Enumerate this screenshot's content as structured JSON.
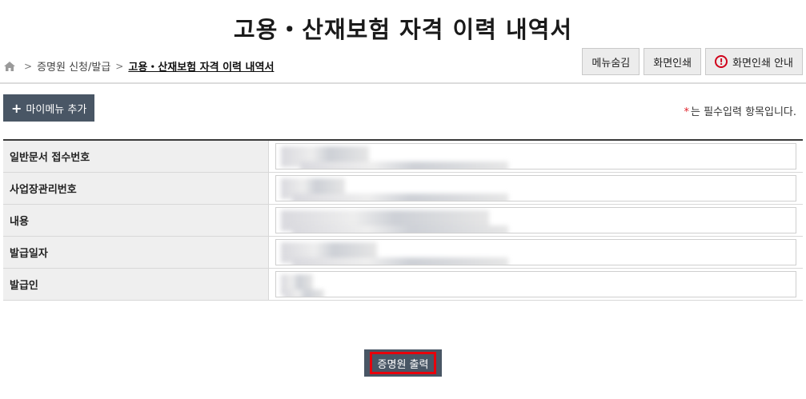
{
  "page": {
    "title": "고용・산재보험 자격 이력 내역서"
  },
  "breadcrumb": {
    "items": [
      "증명원 신청/발급",
      "고용・산재보험 자격 이력 내역서"
    ]
  },
  "top_buttons": {
    "hide_menu": "메뉴숨김",
    "print_screen": "화면인쇄",
    "print_guide": "화면인쇄 안내"
  },
  "my_menu": {
    "label": "마이메뉴 추가"
  },
  "required_note": {
    "star": "*",
    "text": "는 필수입력 항목입니다."
  },
  "form": {
    "rows": [
      {
        "label": "일반문서 접수번호"
      },
      {
        "label": "사업장관리번호"
      },
      {
        "label": "내용"
      },
      {
        "label": "발급일자"
      },
      {
        "label": "발급인"
      }
    ]
  },
  "actions": {
    "print_certificate": "증명원 출력"
  },
  "colors": {
    "accent_dark": "#495665",
    "highlight_red": "#e8000b",
    "required_red": "#e0202a"
  },
  "icons": {
    "home": "home-icon",
    "warning": "warning-circle-icon",
    "plus": "plus-icon"
  }
}
